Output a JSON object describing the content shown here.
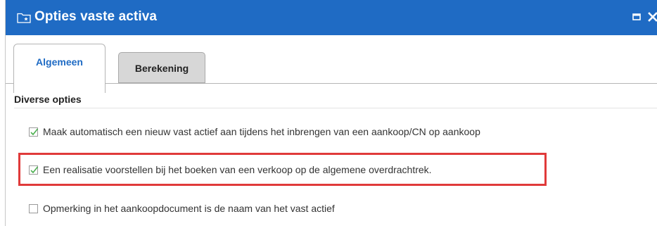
{
  "window": {
    "title": "Opties vaste activa",
    "icon": "folder-star-icon",
    "maximize_icon": "maximize-icon",
    "close_icon": "close-icon",
    "title_bar_color": "#1f6bc4"
  },
  "tabs": [
    {
      "label": "Algemeen",
      "active": true
    },
    {
      "label": "Berekening",
      "active": false
    }
  ],
  "section": {
    "title": "Diverse opties"
  },
  "options": [
    {
      "label": "Maak automatisch een nieuw vast actief aan tijdens het inbrengen van een aankoop/CN op aankoop",
      "checked": true
    },
    {
      "label": "Een realisatie voorstellen bij het boeken van een verkoop op de algemene overdrachtrek.",
      "checked": true,
      "highlighted": true
    },
    {
      "label": "Opmerking in het aankoopdocument is de naam van het vast actief",
      "checked": false
    }
  ],
  "colors": {
    "accent": "#1f6bc4",
    "highlight": "#e03a3a",
    "check": "#4caf50"
  }
}
